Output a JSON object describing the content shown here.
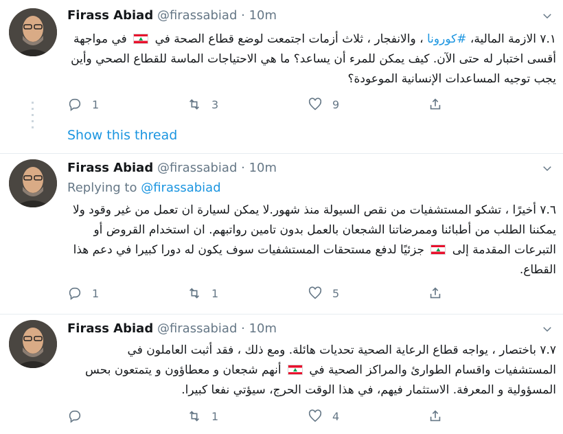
{
  "tweets": [
    {
      "name": "Firass Abiad",
      "handle": "@firassabiad",
      "dot": "·",
      "time": "10m",
      "replying_prefix": "",
      "replying_handle": "",
      "text_parts": [
        "٧.١ الازمة المالية، ",
        "#كورونا",
        " ، والانفجار ، ثلاث أزمات اجتمعت لوضع قطاع الصحة في ",
        " في مواجهة أقسى اختبار له حتى الآن.  كيف يمكن للمرء أن يساعد؟  ما هي الاحتياجات الماسة للقطاع الصحي وأين يجب توجيه المساعدات الإنسانية الموعودة؟"
      ],
      "reply_count": "1",
      "retweet_count": "3",
      "like_count": "9"
    },
    {
      "name": "Firass Abiad",
      "handle": "@firassabiad",
      "dot": "·",
      "time": "10m",
      "replying_prefix": "Replying to ",
      "replying_handle": "@firassabiad",
      "text_parts": [
        "٧.٦ أخيرًا ، تشكو المستشفيات من نقص السيولة منذ شهور.لا يمكن لسيارة ان تعمل من غير وقود ولا يمكننا الطلب من أطبائنا وممرضاتنا الشجعان بالعمل بدون تامين رواتبهم.  ان استخدام القروض أو التبرعات المقدمة إلى ",
        " جزئيًا لدفع مستحقات المستشفيات سوف يكون له دورا كبيرا في دعم هذا القطاع."
      ],
      "reply_count": "1",
      "retweet_count": "1",
      "like_count": "5"
    },
    {
      "name": "Firass Abiad",
      "handle": "@firassabiad",
      "dot": "·",
      "time": "10m",
      "replying_prefix": "",
      "replying_handle": "",
      "text_parts": [
        "٧.٧ باختصار ، يواجه قطاع الرعاية الصحية تحديات هائلة. ومع ذلك ، فقد أثبت العاملون في المستشفيات واقسام الطوارئ والمراكز الصحية في ",
        " أنهم شجعان و معطاؤون و يتمتعون بحس المسؤولية و المعرفة. الاستثمار فيهم، في هذا الوقت الحرج، سيؤتي نفعا كبيرا."
      ],
      "reply_count": "",
      "retweet_count": "1",
      "like_count": "4"
    }
  ],
  "show_thread_label": "Show this thread",
  "icons": {
    "reply": "reply-icon",
    "retweet": "retweet-icon",
    "like": "heart-icon",
    "share": "share-icon",
    "menu": "chevron-down-icon",
    "flag": "lebanon-flag-icon"
  },
  "colors": {
    "link": "#1b95e0",
    "muted": "#657786",
    "text": "#14171a",
    "divider": "#e6ecf0"
  }
}
